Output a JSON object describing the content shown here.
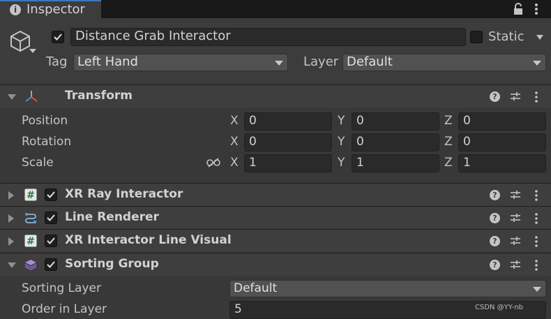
{
  "tab": {
    "title": "Inspector",
    "icon": "info-icon"
  },
  "header": {
    "object_name": "Distance Grab Interactor",
    "active": true,
    "static_label": "Static",
    "static": false,
    "tag_label": "Tag",
    "tag_value": "Left Hand",
    "layer_label": "Layer",
    "layer_value": "Default"
  },
  "transform": {
    "title": "Transform",
    "rows": [
      {
        "label": "Position",
        "x": "0",
        "y": "0",
        "z": "0"
      },
      {
        "label": "Rotation",
        "x": "0",
        "y": "0",
        "z": "0"
      },
      {
        "label": "Scale",
        "x": "1",
        "y": "1",
        "z": "1"
      }
    ],
    "axes": {
      "x": "X",
      "y": "Y",
      "z": "Z"
    }
  },
  "components": [
    {
      "title": "XR Ray Interactor",
      "icon": "script-icon",
      "enabled": true,
      "expanded": false
    },
    {
      "title": "Line Renderer",
      "icon": "line-renderer-icon",
      "enabled": true,
      "expanded": false
    },
    {
      "title": "XR Interactor Line Visual",
      "icon": "script-icon",
      "enabled": true,
      "expanded": false
    },
    {
      "title": "Sorting Group",
      "icon": "sorting-group-icon",
      "enabled": true,
      "expanded": true
    }
  ],
  "sorting_group": {
    "sorting_layer_label": "Sorting Layer",
    "sorting_layer_value": "Default",
    "order_label": "Order in Layer",
    "order_value": "5"
  },
  "watermark": "CSDN @YY-nb",
  "colors": {
    "tab_accent": "#3a79bb",
    "background": "#383838",
    "header_bg": "#3e3e3e",
    "field_bg": "#2a2a2a"
  }
}
